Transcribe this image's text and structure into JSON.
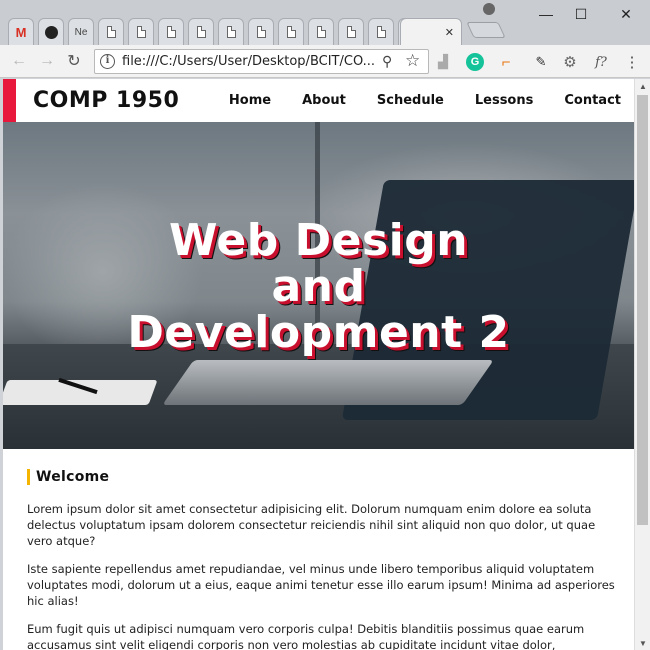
{
  "browser": {
    "tabs": [
      {
        "kind": "gmail",
        "label": "M"
      },
      {
        "kind": "github",
        "label": ""
      },
      {
        "kind": "text",
        "label": "Ne"
      },
      {
        "kind": "page",
        "label": ""
      },
      {
        "kind": "page",
        "label": ""
      },
      {
        "kind": "page",
        "label": ""
      },
      {
        "kind": "page",
        "label": ""
      },
      {
        "kind": "page",
        "label": ""
      },
      {
        "kind": "page",
        "label": ""
      },
      {
        "kind": "page",
        "label": ""
      },
      {
        "kind": "page",
        "label": ""
      },
      {
        "kind": "page",
        "label": ""
      },
      {
        "kind": "page",
        "label": ""
      },
      {
        "kind": "page",
        "label": ""
      },
      {
        "kind": "active",
        "label": "✕"
      }
    ],
    "url": "file:///C:/Users/User/Desktop/BCIT/CO...",
    "icons": [
      "back-icon",
      "forward-icon",
      "reload-icon",
      "info-icon",
      "zoom-icon",
      "star-icon",
      "pdf-icon",
      "grammarly-icon",
      "tag-icon",
      "eyedropper-icon",
      "gear-icon",
      "fx-icon",
      "menu-icon"
    ]
  },
  "site": {
    "logo": "COMP 1950",
    "nav": [
      "Home",
      "About",
      "Schedule",
      "Lessons",
      "Contact"
    ],
    "hero_lines": [
      "Web Design",
      "and",
      "Development 2"
    ],
    "section_heading": "Welcome",
    "paragraphs": [
      "Lorem ipsum dolor sit amet consectetur adipisicing elit. Dolorum numquam enim dolore ea soluta delectus voluptatum ipsam dolorem consectetur reiciendis nihil sint aliquid non quo dolor, ut quae vero atque?",
      "Iste sapiente repellendus amet repudiandae, vel minus unde libero temporibus aliquid voluptatem voluptates modi, dolorum ut a eius, eaque animi tenetur esse illo earum ipsum! Minima ad asperiores hic alias!",
      "Eum fugit quis ut adipisci numquam vero corporis culpa! Debitis blanditiis possimus quae earum accusamus sint velit eligendi corporis non vero molestias ab cupiditate incidunt vitae dolor,"
    ]
  },
  "colors": {
    "accent": "#e8173c",
    "heading_marker": "#f4b400",
    "hero_shadow": "#c8102e"
  }
}
